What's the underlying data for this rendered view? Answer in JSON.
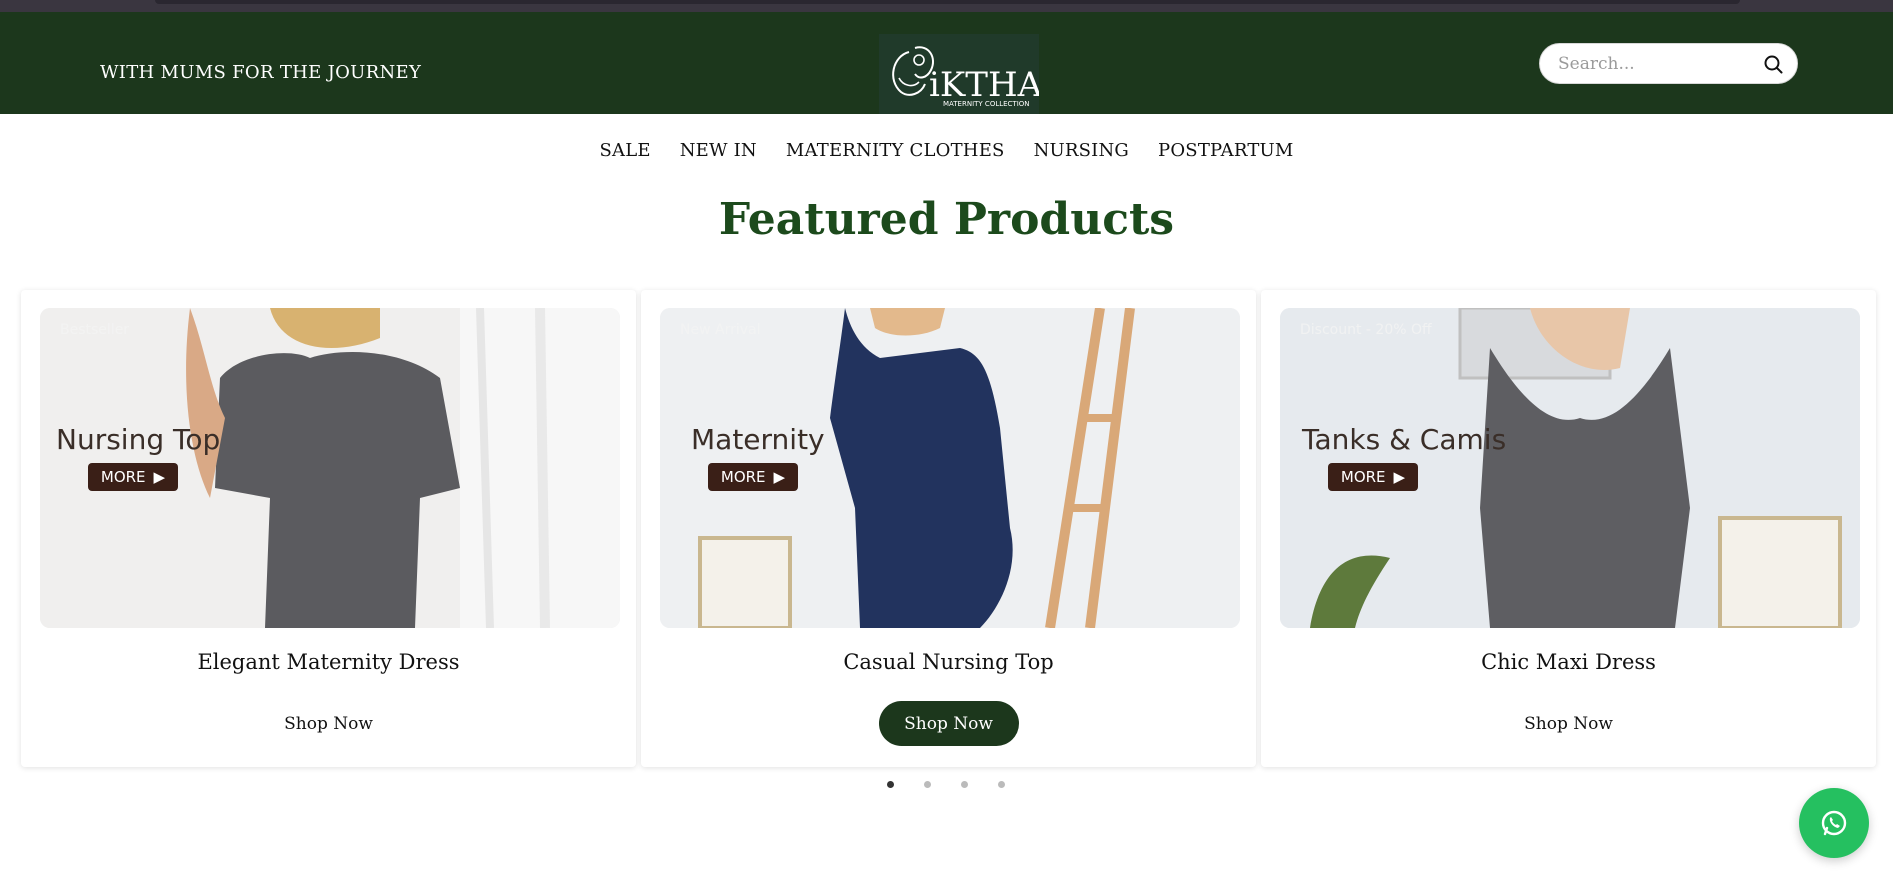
{
  "header": {
    "tagline": "WITH MUMS FOR THE JOURNEY",
    "logo_text": "iKTHA",
    "logo_subtext": "MATERNITY COLLECTION",
    "search_placeholder": "Search..."
  },
  "nav": {
    "items": [
      {
        "label": "SALE"
      },
      {
        "label": "NEW IN"
      },
      {
        "label": "MATERNITY CLOTHES"
      },
      {
        "label": "NURSING"
      },
      {
        "label": "POSTPARTUM"
      }
    ]
  },
  "featured": {
    "title": "Featured Products",
    "products": [
      {
        "badge": "Bestseller",
        "banner": "Nursing Top",
        "more": "MORE",
        "name": "Elegant Maternity Dress",
        "shop": "Shop Now",
        "shirt_color": "#5b5b5f"
      },
      {
        "badge": "New Arrival",
        "banner": "Maternity",
        "more": "MORE",
        "name": "Casual Nursing Top",
        "shop": "Shop Now",
        "shirt_color": "#22335e"
      },
      {
        "badge": "Discount - 20% Off",
        "banner": "Tanks & Camis",
        "more": "MORE",
        "name": "Chic Maxi Dress",
        "shop": "Shop Now",
        "shirt_color": "#5e5e62"
      }
    ],
    "active_dot": 1,
    "dot_count": 4
  },
  "colors": {
    "header_bg": "#1c371c",
    "accent": "#1c371c",
    "title_green": "#1c4a1c",
    "whatsapp": "#25c060"
  },
  "icons": {
    "search": "search-icon",
    "whatsapp": "whatsapp-icon",
    "more_arrow": "play-arrow-icon"
  }
}
